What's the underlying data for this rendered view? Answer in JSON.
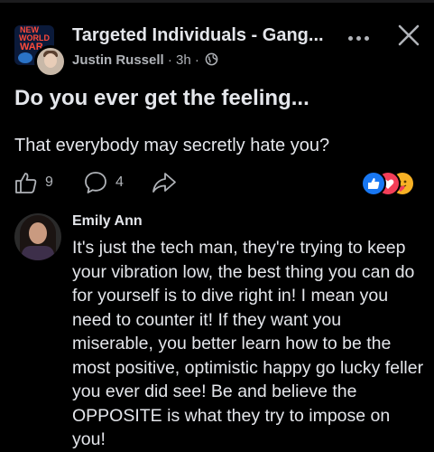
{
  "post": {
    "group_name": "Targeted Individuals - Gang...",
    "group_logo": {
      "line1": "NEW",
      "line2": "WORLD",
      "line3": "WAR"
    },
    "author": "Justin Russell",
    "separator": " · ",
    "time": "3h",
    "separator2": " · ",
    "title": "Do you ever get the feeling...",
    "body": "That everybody may secretly hate you?",
    "likes": "9",
    "comments": "4",
    "reaction_icons": [
      "like-icon",
      "love-icon",
      "care-icon"
    ]
  },
  "comment": {
    "author": "Emily Ann",
    "text": "It's just the tech man, they're trying to keep your vibration low, the best thing you can do for yourself is to dive right in! I mean you need to counter it! If they want you miserable, you better learn how to be the most positive, optimistic happy go lucky feller you ever did see! Be and believe the OPPOSITE is what they try to impose on you!"
  },
  "colors": {
    "background": "#000000",
    "text": "#e4e6eb",
    "secondary_text": "#b0b3b8",
    "like_blue": "#1877f2",
    "love_red": "#f33e58",
    "care_yellow": "#f7b125"
  }
}
